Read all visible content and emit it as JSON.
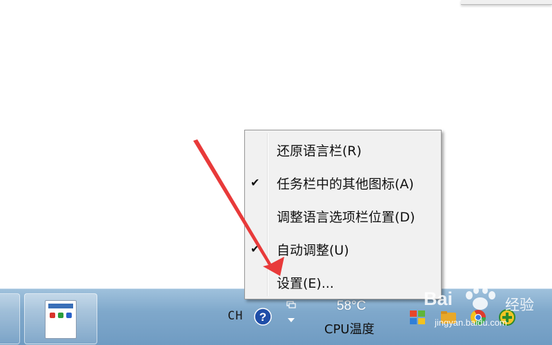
{
  "context_menu": {
    "items": [
      {
        "label": "还原语言栏(R)",
        "checked": false
      },
      {
        "label": "任务栏中的其他图标(A)",
        "checked": true
      },
      {
        "label": "调整语言选项栏位置(D)",
        "checked": false
      },
      {
        "label": "自动调整(U)",
        "checked": true
      },
      {
        "label": "设置(E)...",
        "checked": false
      }
    ],
    "check_glyph": "✔"
  },
  "taskbar": {
    "language_indicator": "CH",
    "help_icon": "help-icon",
    "cpu_temp_value": "58°C",
    "cpu_temp_label": "CPU温度"
  },
  "watermark": {
    "brand": "Bai",
    "brand_sub": "经验",
    "url": "jingyan.baidu.com"
  },
  "colors": {
    "arrow": "#e83a3a",
    "taskbar": "#7fa8cb",
    "menu_bg": "#f1f1f1"
  }
}
